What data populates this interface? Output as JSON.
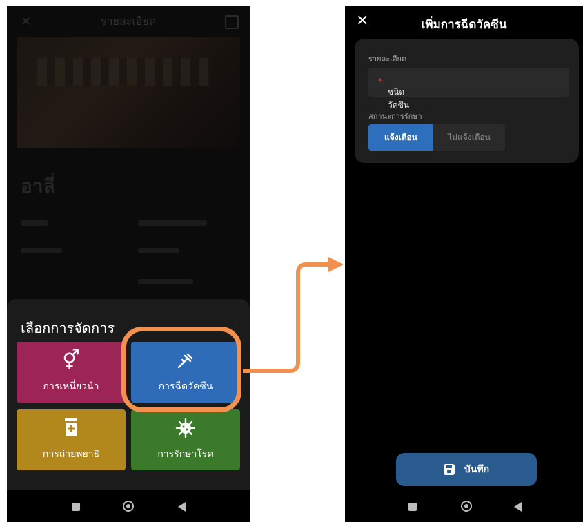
{
  "left": {
    "background": {
      "header_title": "รายละเอียด",
      "animal_name": "อาลี่"
    },
    "sheet": {
      "title": "เลือกการจัดการ",
      "tiles": [
        {
          "label": "การเหนี่ยวนำ",
          "icon": "gender-icon",
          "color": "#9c2556"
        },
        {
          "label": "การฉีดวัคซีน",
          "icon": "syringe-icon",
          "color": "#2f6cb8"
        },
        {
          "label": "การถ่ายพยาธิ",
          "icon": "medicine-bottle-icon",
          "color": "#b2881c"
        },
        {
          "label": "การรักษาโรค",
          "icon": "virus-icon",
          "color": "#3b7a2b"
        }
      ]
    },
    "highlight_color": "#f0914f"
  },
  "right": {
    "title": "เพิ่มการฉีดวัคซีน",
    "close_icon": "close-icon",
    "card": {
      "section_details": "รายละเอียด",
      "vaccine_type_label": "ชนิดวัคซีน",
      "required_mark": "*",
      "section_status": "สถานะการรักษา",
      "toggle_on": "แจ้งเตือน",
      "toggle_off": "ไม่แจ้งเตือน"
    },
    "save_label": "บันทึก",
    "accent": "#2d6fbc"
  }
}
